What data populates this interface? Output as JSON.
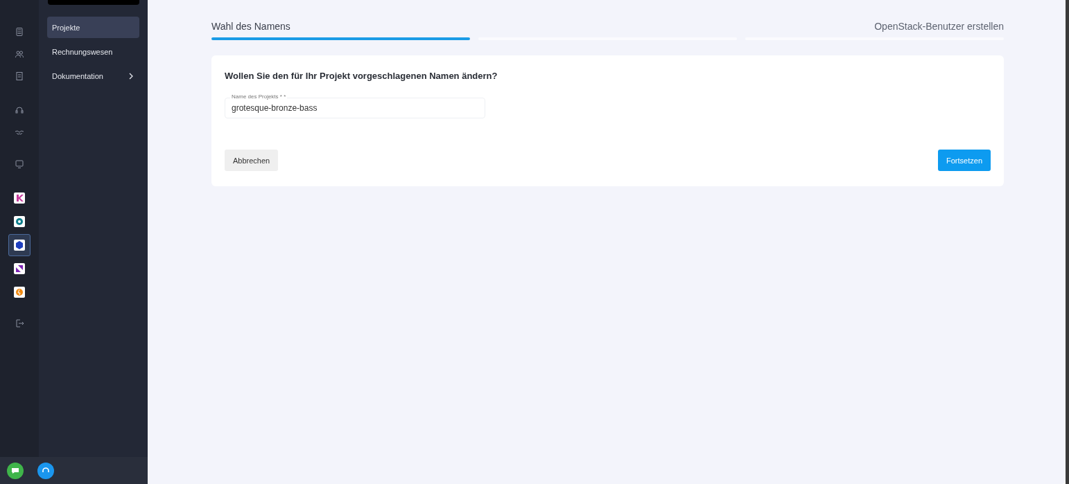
{
  "nav": {
    "items": [
      {
        "label": "Projekte",
        "selected": true,
        "has_submenu": false
      },
      {
        "label": "Rechnungswesen",
        "selected": false,
        "has_submenu": false
      },
      {
        "label": "Dokumentation",
        "selected": false,
        "has_submenu": true
      }
    ]
  },
  "rail": {
    "apps": [
      {
        "kind": "k",
        "selected": false
      },
      {
        "kind": "circle",
        "selected": false
      },
      {
        "kind": "cube",
        "selected": true
      },
      {
        "kind": "arrow",
        "selected": false
      },
      {
        "kind": "flame",
        "selected": false
      }
    ]
  },
  "stepper": {
    "steps": [
      {
        "label": "Wahl des Namens",
        "active": true
      },
      {
        "active": false
      },
      {
        "label": "OpenStack-Benutzer erstellen",
        "active": false
      }
    ]
  },
  "form": {
    "question": "Wollen Sie den für Ihr Projekt vorgeschlagenen Namen ändern?",
    "field": {
      "label": "Name des Projekts * *",
      "value": "grotesque-bronze-bass"
    },
    "cancel": "Abbrechen",
    "continue": "Fortsetzen"
  }
}
